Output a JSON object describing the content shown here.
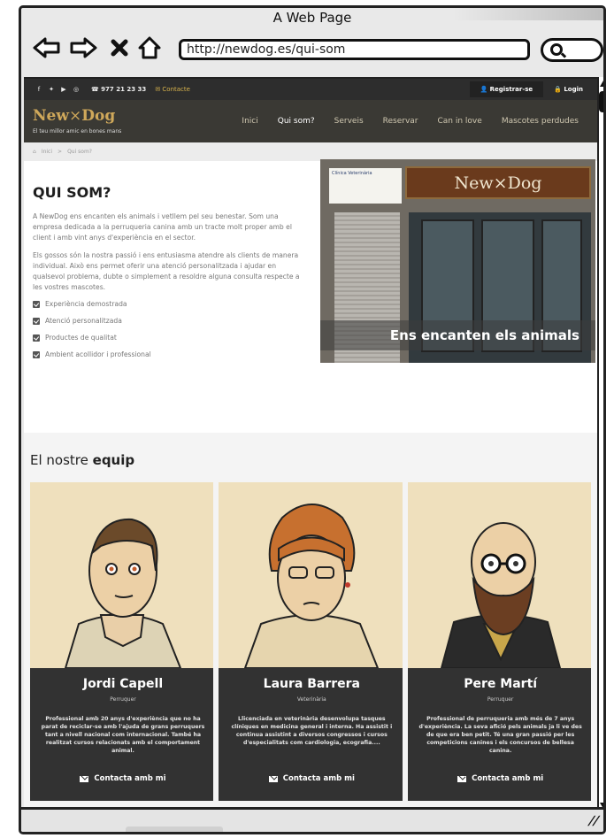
{
  "window": {
    "title": "A Web Page",
    "url": "http://newdog.es/qui-som"
  },
  "browser_icons": [
    "back-arrow-icon",
    "forward-arrow-icon",
    "close-x-icon",
    "home-icon",
    "search-icon"
  ],
  "topbar": {
    "social": [
      "facebook-icon",
      "twitter-icon",
      "youtube-icon",
      "instagram-icon"
    ],
    "phone": "977 21 23 33",
    "contact": "Contacte",
    "register": "Registrar-se",
    "login": "Login"
  },
  "brand": {
    "name_left": "New",
    "name_sep": "×",
    "name_right": "Dog",
    "tagline": "El teu millor amic en bones mans"
  },
  "menu": [
    {
      "label": "Inici",
      "active": false
    },
    {
      "label": "Qui som?",
      "active": true
    },
    {
      "label": "Serveis",
      "active": false
    },
    {
      "label": "Reservar",
      "active": false
    },
    {
      "label": "Can in love",
      "active": false
    },
    {
      "label": "Mascotes perdudes",
      "active": false
    }
  ],
  "breadcrumb": {
    "home": "Inici",
    "separator": ">",
    "current": "Qui som?"
  },
  "about": {
    "title": "QUI SOM?",
    "paragraph1": "A NewDog ens encanten els animals i vetllem pel seu benestar. Som una empresa dedicada a la perruqueria canina amb un tracte molt proper amb el client i amb vint anys d'experiència en el sector.",
    "paragraph2": "Els gossos són la nostra passió i ens entusiasma atendre als clients de manera individual. Això ens permet oferir una atenció personalitzada i ajudar en qualsevol problema, dubte o simplement a resoldre alguna consulta respecte a les vostres mascotes.",
    "features": [
      "Experiència demostrada",
      "Atenció personalitzada",
      "Productes de qualitat",
      "Ambient acollidor i professional"
    ],
    "image_caption": "Ens encanten els animals",
    "shop_sign": "New×Dog",
    "clinic_sign": "Clínica Veterinària"
  },
  "team": {
    "title_normal": "El nostre ",
    "title_bold": "equip",
    "contact_label": "Contacta amb mi",
    "members": [
      {
        "name": "Jordi Capell",
        "role": "Perruquer",
        "bio": "Professional amb 20 anys d'experiència que no ha parat de reciclar-se amb l'ajuda de grans perruquers tant a nivell nacional com internacional. També ha realitzat cursos relacionats amb el comportament animal."
      },
      {
        "name": "Laura Barrera",
        "role": "Veterinària",
        "bio": "Llicenciada en veterinària desenvolupa tasques clíniques en medicina general i interna. Ha assistit i continua assistint a diversos congressos i cursos d'especialitats com cardiologia, ecografia...."
      },
      {
        "name": "Pere Martí",
        "role": "Perruquer",
        "bio": "Professional de perruqueria amb més de 7 anys d'experiència. La seva afició pels animals ja li ve des de que era ben petit. Té una gran passió per les competicions canines i els concursos de bellesa canina."
      }
    ]
  }
}
